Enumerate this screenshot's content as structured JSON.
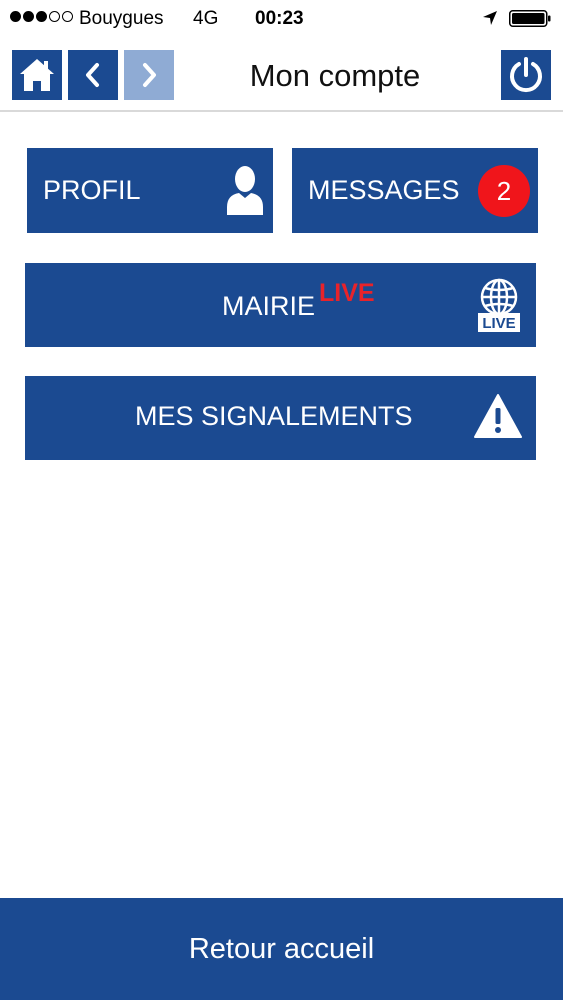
{
  "status_bar": {
    "carrier": "Bouygues",
    "network": "4G",
    "time": "00:23",
    "signal_bars_filled": 3,
    "signal_bars_total": 5
  },
  "header": {
    "title": "Mon compte",
    "icons": {
      "home": "home-icon",
      "back": "chevron-left-icon",
      "forward": "chevron-right-icon",
      "power": "power-icon"
    }
  },
  "tiles": {
    "profil": {
      "label": "PROFIL",
      "icon": "user-icon"
    },
    "messages": {
      "label": "MESSAGES",
      "badge_count": "2"
    },
    "mairie": {
      "label": "MAIRIE",
      "live": "LIVE",
      "icon": "globe-live-icon",
      "icon_text": "LIVE"
    },
    "signalements": {
      "label": "MES SIGNALEMENTS",
      "icon": "warning-icon"
    }
  },
  "footer": {
    "label": "Retour accueil"
  },
  "colors": {
    "primary": "#1b4a91",
    "primary_disabled": "#8fabd4",
    "badge": "#f0151b",
    "live": "#e8232a"
  }
}
